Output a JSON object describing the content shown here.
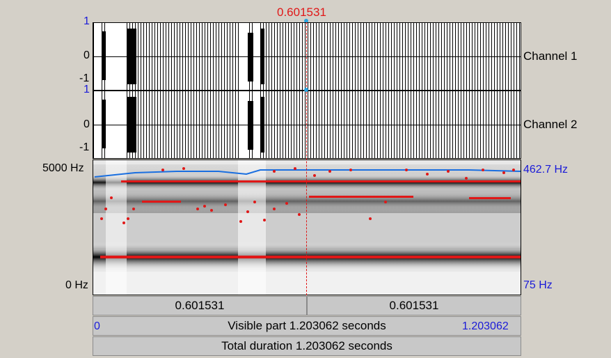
{
  "cursor": {
    "time_label": "0.601531"
  },
  "waveform": {
    "channel1": {
      "label": "Channel 1",
      "top_tick": "1",
      "mid_tick": "0",
      "bottom_tick": "-1"
    },
    "channel2": {
      "label": "Channel 2",
      "top_tick": "1",
      "mid_tick": "0",
      "bottom_tick": "-1"
    }
  },
  "spectrogram": {
    "freq_top": "5000 Hz",
    "freq_bottom": "0 Hz",
    "pitch_top": "462.7 Hz",
    "pitch_bottom": "75 Hz"
  },
  "time_bars": {
    "left_segment": "0.601531",
    "right_segment": "0.601531",
    "visible_start": "0",
    "visible_text": "Visible part 1.203062 seconds",
    "visible_end": "1.203062",
    "total_text": "Total duration 1.203062 seconds"
  },
  "colors": {
    "cursor": "#e01818",
    "formant": "#e01818",
    "pitch": "#1a6fe0",
    "axis_blue": "#1a1ad8"
  }
}
